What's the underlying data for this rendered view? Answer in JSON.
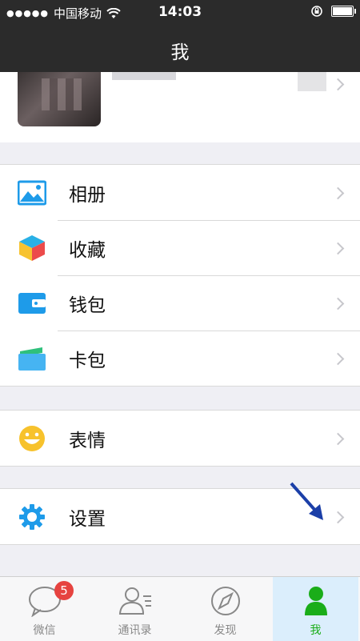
{
  "status_bar": {
    "signal_dots": "●●●●●",
    "carrier": "中国移动",
    "time": "14:03",
    "wifi_icon": "wifi-icon",
    "orientation_lock_icon": "orientation-lock-icon",
    "battery_icon": "battery-icon"
  },
  "nav": {
    "title": "我"
  },
  "menu_groups": [
    {
      "items": [
        {
          "label": "相册",
          "icon": "photo-album-icon"
        },
        {
          "label": "收藏",
          "icon": "favorites-cube-icon"
        },
        {
          "label": "钱包",
          "icon": "wallet-icon"
        },
        {
          "label": "卡包",
          "icon": "card-pack-icon"
        }
      ]
    },
    {
      "items": [
        {
          "label": "表情",
          "icon": "sticker-smiley-icon"
        }
      ]
    },
    {
      "items": [
        {
          "label": "设置",
          "icon": "settings-gear-icon"
        }
      ]
    }
  ],
  "tab_bar": {
    "tabs": [
      {
        "label": "微信",
        "badge": "5",
        "icon": "chats-bubble-icon",
        "active": false
      },
      {
        "label": "通讯录",
        "icon": "contacts-icon",
        "active": false
      },
      {
        "label": "发现",
        "icon": "discover-compass-icon",
        "active": false
      },
      {
        "label": "我",
        "icon": "me-person-icon",
        "active": true
      }
    ]
  },
  "colors": {
    "nav_background": "#2b2b2b",
    "active_tab": "#1aad19",
    "badge": "#e64340",
    "icon_blue": "#1e9be9"
  }
}
